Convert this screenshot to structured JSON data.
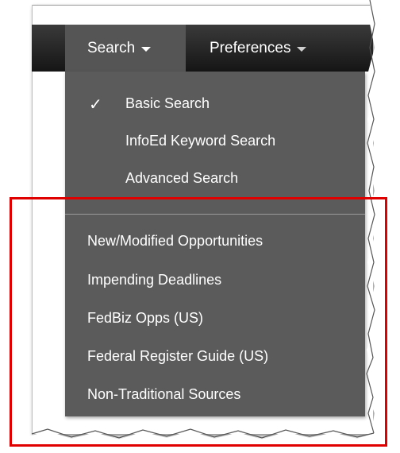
{
  "menubar": {
    "search_label": "Search",
    "preferences_label": "Preferences"
  },
  "dropdown": {
    "top_items": [
      {
        "label": "Basic Search",
        "checked": true
      },
      {
        "label": "InfoEd Keyword Search",
        "checked": false
      },
      {
        "label": "Advanced Search",
        "checked": false
      }
    ],
    "check_glyph": "✓",
    "bottom_items": [
      {
        "label": "New/Modified Opportunities"
      },
      {
        "label": "Impending Deadlines"
      },
      {
        "label": "FedBiz Opps (US)"
      },
      {
        "label": "Federal Register Guide (US)"
      },
      {
        "label": "Non-Traditional Sources"
      }
    ]
  },
  "colors": {
    "menubar": "#202020",
    "active_tab": "#555555",
    "dropdown": "#5b5b5b",
    "highlight_box": "#e00000"
  }
}
